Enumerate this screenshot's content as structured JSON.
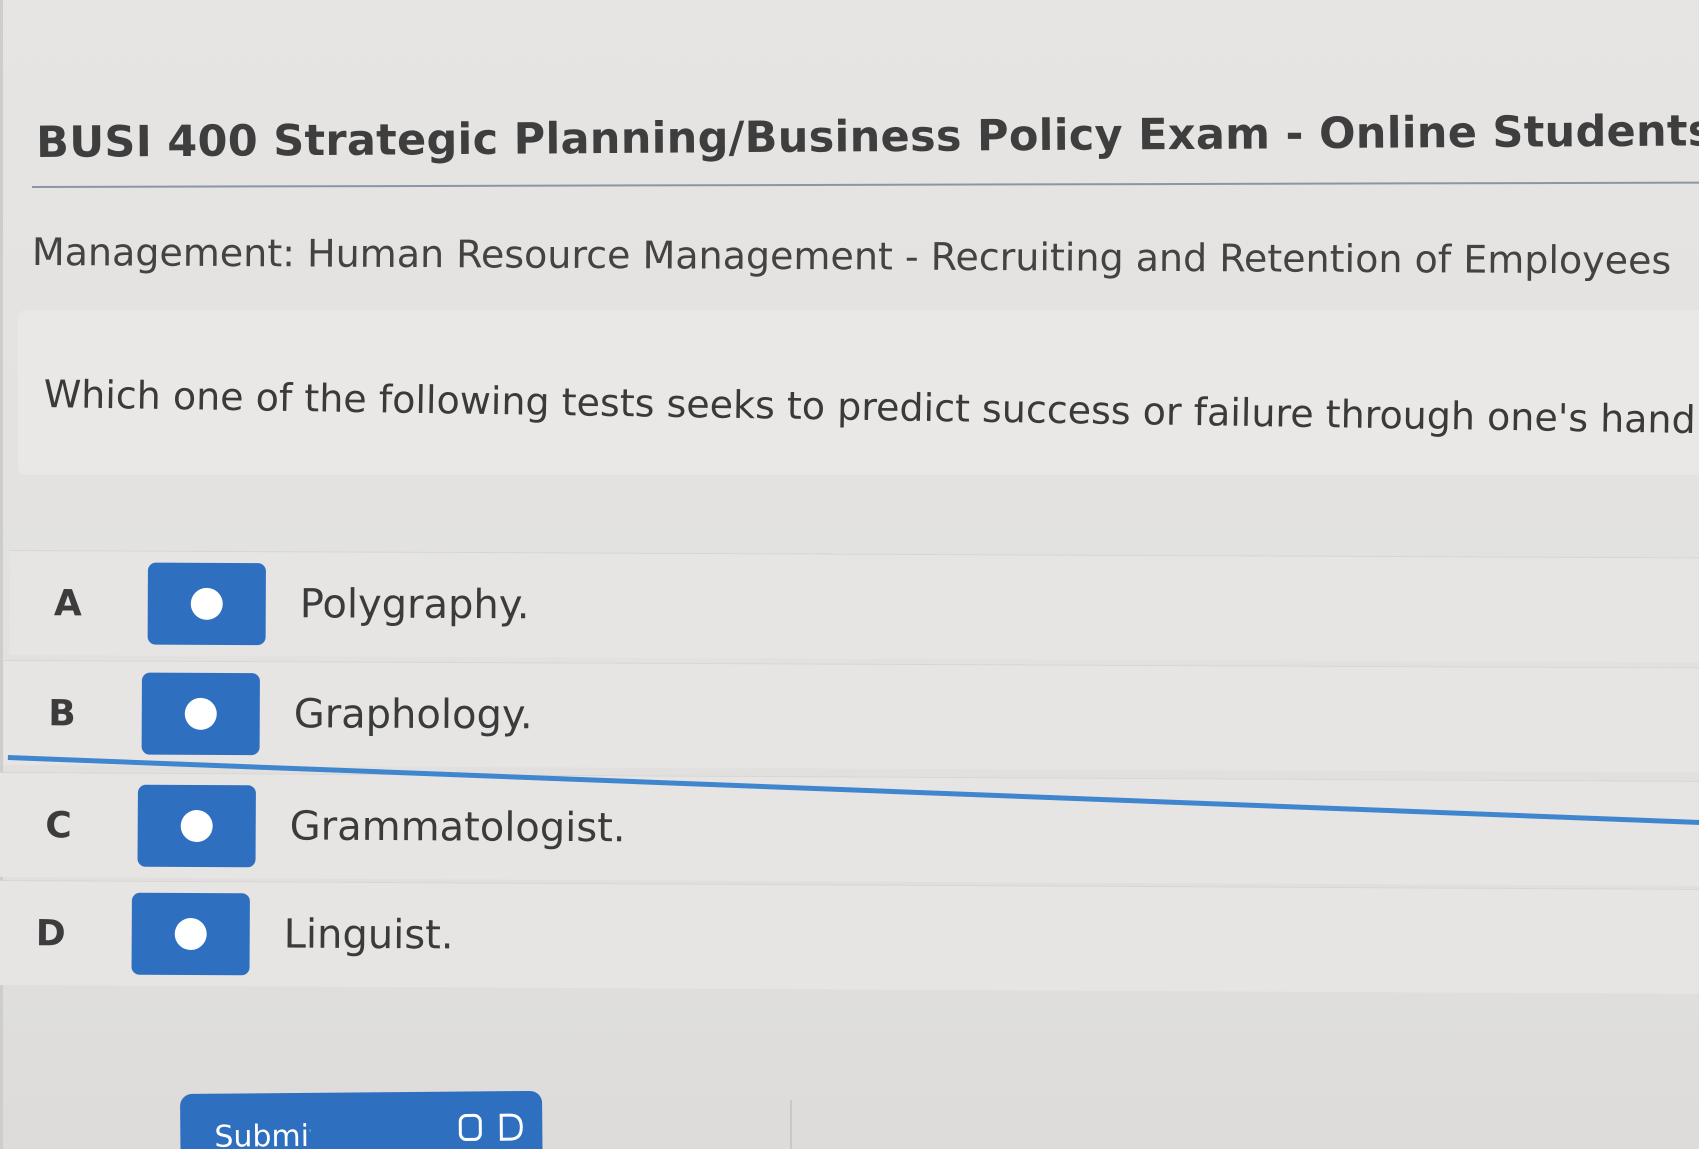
{
  "header": {
    "title": "BUSI 400 Strategic Planning/Business Policy Exam - Online Students",
    "topic": "Management: Human Resource Management - Recruiting and Retention of Employees"
  },
  "question": {
    "text": "Which one of the following tests seeks to predict success or failure through one's hand"
  },
  "choices": [
    {
      "letter": "A",
      "text": "Polygraphy."
    },
    {
      "letter": "B",
      "text": "Graphology."
    },
    {
      "letter": "C",
      "text": "Grammatologist."
    },
    {
      "letter": "D",
      "text": "Linguist."
    }
  ],
  "submit": {
    "label": "Submit Answer"
  },
  "colors": {
    "accent": "#2f6fc0",
    "rule_blue": "#3f86cf",
    "background": "#e4e3e1"
  }
}
